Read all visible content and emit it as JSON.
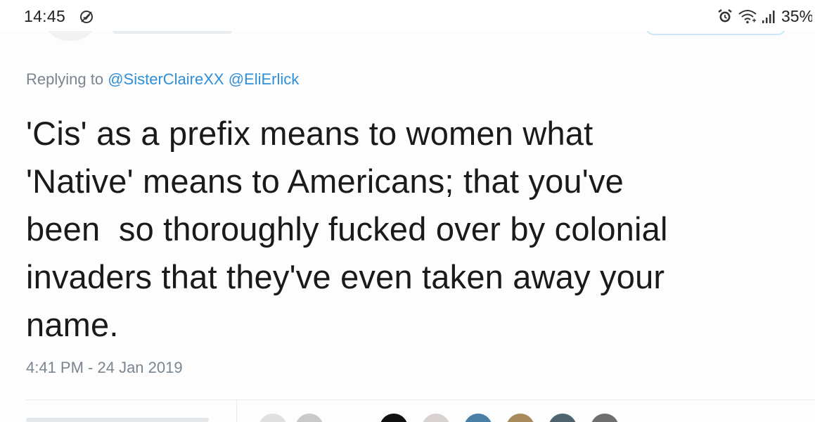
{
  "status_bar": {
    "time": "14:45",
    "battery": "35%"
  },
  "tweet": {
    "reply_prefix": "Replying to",
    "reply_mentions": [
      "@SisterClaireXX",
      "@EliErlick"
    ],
    "text": "'Cis' as a prefix means to women what\n'Native' means to Americans; that you've\nbeen  so thoroughly fucked over by colonial\ninvaders that they've even taken away your\nname.",
    "timestamp": "4:41 PM - 24 Jan 2019"
  },
  "icons": {
    "status_left": "check-circle-icon",
    "status_right": [
      "alarm-icon",
      "wifi-icon",
      "signal-icon"
    ]
  },
  "colors": {
    "mention": "#2f8fd8",
    "meta_text": "#7a8590",
    "body_text": "#1a1a1a"
  }
}
